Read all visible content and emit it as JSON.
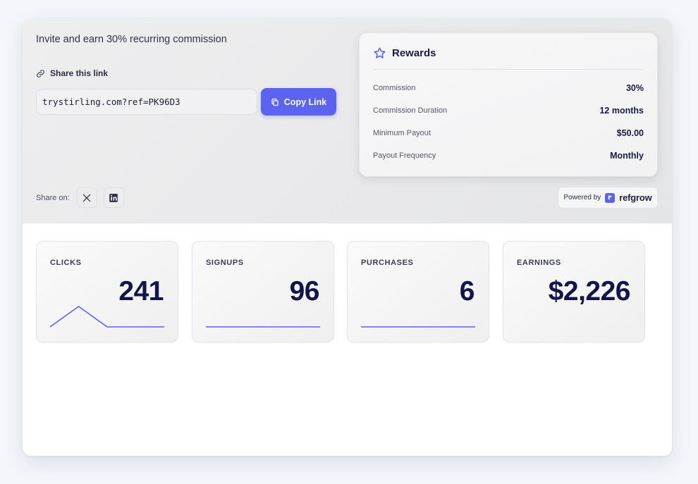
{
  "invite": {
    "headline": "Invite and earn 30% recurring commission",
    "share_link_label": "Share this link",
    "link_value": "trystirling.com?ref=PK96D3",
    "copy_button_label": "Copy Link",
    "share_on_label": "Share on:"
  },
  "rewards": {
    "title": "Rewards",
    "rows": [
      {
        "label": "Commission",
        "value": "30%"
      },
      {
        "label": "Commission Duration",
        "value": "12 months"
      },
      {
        "label": "Minimum Payout",
        "value": "$50.00"
      },
      {
        "label": "Payout Frequency",
        "value": "Monthly"
      }
    ]
  },
  "powered_by": {
    "label": "Powered by",
    "brand": "refgrow"
  },
  "stats": [
    {
      "label": "CLICKS",
      "value": "241",
      "sparkline": [
        0,
        1,
        0,
        0,
        0
      ]
    },
    {
      "label": "SIGNUPS",
      "value": "96",
      "sparkline": [
        0,
        0,
        0,
        0,
        0
      ]
    },
    {
      "label": "PURCHASES",
      "value": "6",
      "sparkline": [
        0,
        0,
        0,
        0,
        0
      ]
    },
    {
      "label": "EARNINGS",
      "value": "$2,226"
    }
  ],
  "colors": {
    "accent": "#5b63f0",
    "title_text": "#13154a"
  },
  "icons": {
    "link": "link-icon",
    "copy": "copy-icon",
    "x": "x-logo-icon",
    "linkedin": "linkedin-icon",
    "rewards": "star-icon",
    "brand": "refgrow-logo-icon"
  }
}
